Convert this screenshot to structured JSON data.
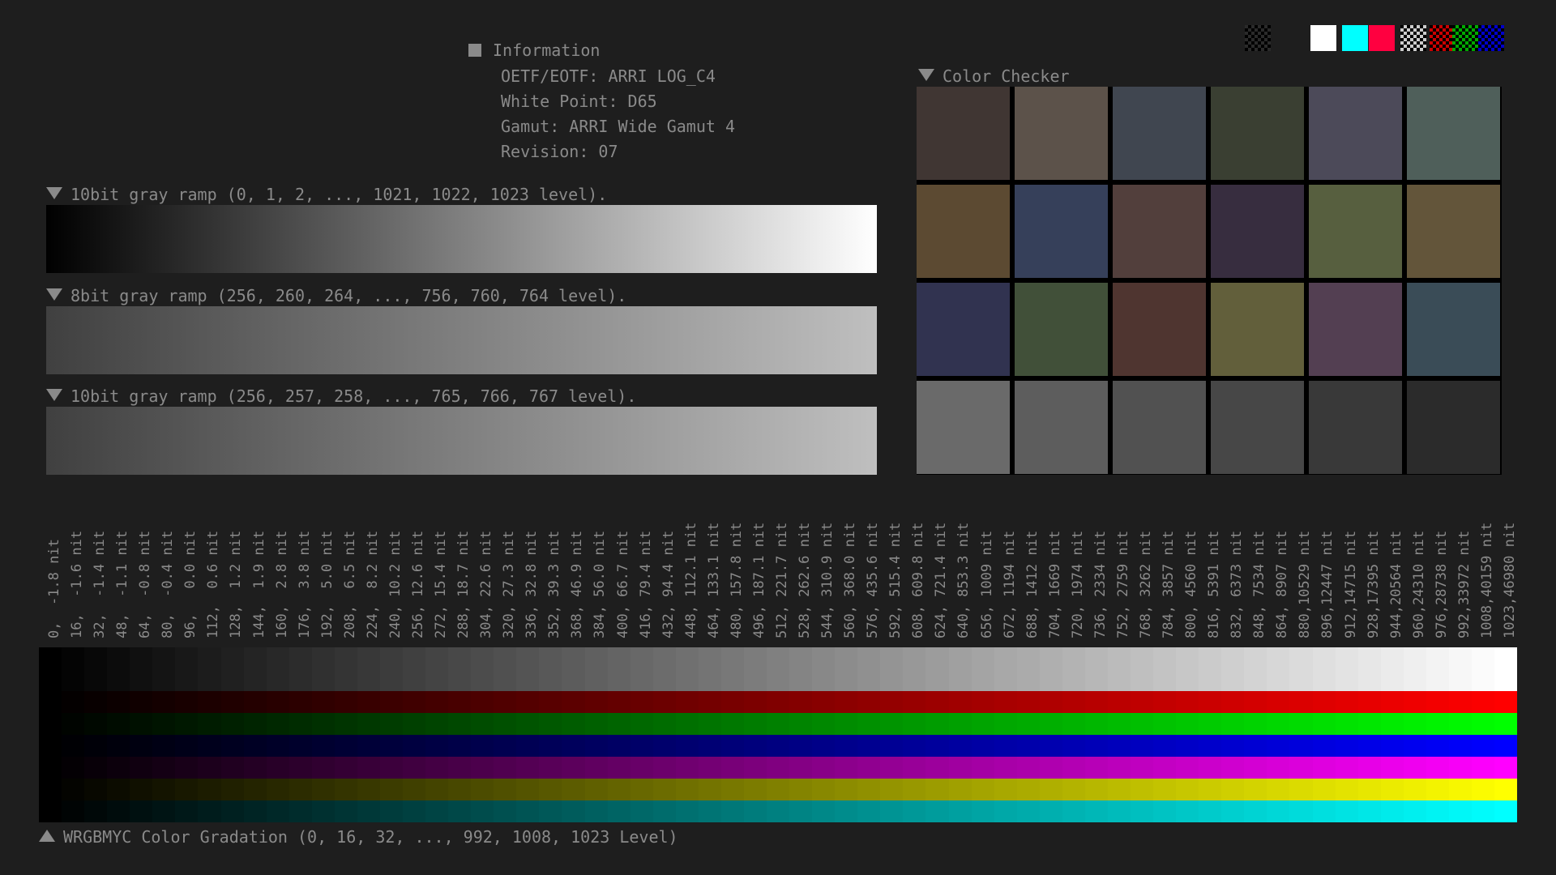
{
  "info": {
    "title": "Information",
    "lines": [
      "OETF/EOTF: ARRI LOG_C4",
      "White Point: D65",
      "Gamut: ARRI Wide Gamut 4",
      "Revision: 07"
    ]
  },
  "ramps": [
    {
      "label": "10bit gray ramp (0, 1, 2, ..., 1021, 1022, 1023 level).",
      "from": "#000000",
      "to": "#ffffff"
    },
    {
      "label": "8bit gray ramp (256, 260, 264, ..., 756, 760, 764 level).",
      "from": "#404040",
      "to": "#bfbfbf"
    },
    {
      "label": "10bit gray ramp (256, 257, 258, ..., 765, 766, 767 level).",
      "from": "#404040",
      "to": "#bfbfbf"
    }
  ],
  "color_checker": {
    "title": "Color Checker",
    "patches": [
      "#403633",
      "#5c524a",
      "#404650",
      "#3a3f32",
      "#4c4a59",
      "#4f5f5a",
      "#5c4a32",
      "#36405a",
      "#523f3c",
      "#372d3f",
      "#575f3f",
      "#63553a",
      "#313350",
      "#415039",
      "#4f3530",
      "#625f3b",
      "#533f52",
      "#3a4c57",
      "#6a6a6a",
      "#5d5d5d",
      "#515151",
      "#474747",
      "#393939",
      "#2b2b2b"
    ]
  },
  "top_swatches": [
    {
      "name": "black-checker-swatch",
      "color": "#000000"
    },
    {
      "name": "white-swatch",
      "color": "#ffffff"
    },
    {
      "name": "cyan-swatch",
      "color": "#00ffff"
    },
    {
      "name": "magenta-red-swatch",
      "color": "#ff0040"
    },
    {
      "name": "white-checker-swatch",
      "color": "#cccccc"
    },
    {
      "name": "red-checker-swatch",
      "color": "#cc0000"
    },
    {
      "name": "green-checker-swatch",
      "color": "#00aa00"
    },
    {
      "name": "blue-checker-swatch",
      "color": "#0000cc"
    }
  ],
  "nit_labels": [
    "0,  -1.8 nit",
    "16,  -1.6 nit",
    "32,  -1.4 nit",
    "48,  -1.1 nit",
    "64,  -0.8 nit",
    "80,  -0.4 nit",
    "96,   0.0 nit",
    "112,  0.6 nit",
    "128,  1.2 nit",
    "144,  1.9 nit",
    "160,  2.8 nit",
    "176,  3.8 nit",
    "192,  5.0 nit",
    "208,  6.5 nit",
    "224,  8.2 nit",
    "240, 10.2 nit",
    "256, 12.6 nit",
    "272, 15.4 nit",
    "288, 18.7 nit",
    "304, 22.6 nit",
    "320, 27.3 nit",
    "336, 32.8 nit",
    "352, 39.3 nit",
    "368, 46.9 nit",
    "384, 56.0 nit",
    "400, 66.7 nit",
    "416, 79.4 nit",
    "432, 94.4 nit",
    "448, 112.1 nit",
    "464, 133.1 nit",
    "480, 157.8 nit",
    "496, 187.1 nit",
    "512, 221.7 nit",
    "528, 262.6 nit",
    "544, 310.9 nit",
    "560, 368.0 nit",
    "576, 435.6 nit",
    "592, 515.4 nit",
    "608, 609.8 nit",
    "624, 721.4 nit",
    "640, 853.3 nit",
    "656, 1009 nit",
    "672, 1194 nit",
    "688, 1412 nit",
    "704, 1669 nit",
    "720, 1974 nit",
    "736, 2334 nit",
    "752, 2759 nit",
    "768, 3262 nit",
    "784, 3857 nit",
    "800, 4560 nit",
    "816, 5391 nit",
    "832, 6373 nit",
    "848, 7534 nit",
    "864, 8907 nit",
    "880,10529 nit",
    "896,12447 nit",
    "912,14715 nit",
    "928,17395 nit",
    "944,20564 nit",
    "960,24310 nit",
    "976,28738 nit",
    "992,33972 nit",
    "1008,40159 nit",
    "1023,46980 nit"
  ],
  "gradation": {
    "label": "WRGBMYC Color Gradation (0, 16, 32, ..., 992, 1008, 1023 Level)",
    "rows": [
      {
        "name": "white",
        "rgb": [
          1,
          1,
          1
        ]
      },
      {
        "name": "red",
        "rgb": [
          1,
          0,
          0
        ]
      },
      {
        "name": "green",
        "rgb": [
          0,
          1,
          0
        ]
      },
      {
        "name": "blue",
        "rgb": [
          0,
          0,
          1
        ]
      },
      {
        "name": "magenta",
        "rgb": [
          1,
          0,
          1
        ]
      },
      {
        "name": "yellow",
        "rgb": [
          1,
          1,
          0
        ]
      },
      {
        "name": "cyan",
        "rgb": [
          0,
          1,
          1
        ]
      }
    ],
    "steps": 65
  }
}
